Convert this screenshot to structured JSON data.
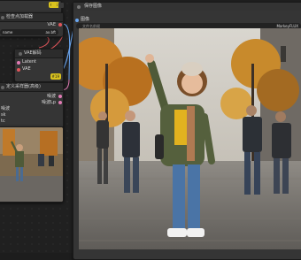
{
  "nodes": {
    "top_left_fragment": {
      "title_tail": "",
      "badge_text": "#16"
    },
    "load_checkpoint": {
      "title": "检查点加载器",
      "vae_label": "VAE",
      "ckpt_value": "ax.bft",
      "ckpt_label": "name"
    },
    "vae_decode": {
      "title": "VAE解码",
      "input_latent": "Latent",
      "input_vae": "VAE",
      "badge_text": "#19"
    },
    "ksampler": {
      "title": "定义采样器(高级)",
      "row1": "噪波",
      "row2": "sk",
      "row3": "tc",
      "right1": "噪波",
      "right2": "噪波Lp"
    },
    "save_image": {
      "title": "保存图像",
      "input_images": "图像",
      "filename_label": "文件名前缀",
      "filename_value": "MarkeyFLUX",
      "badge_text": "#19"
    }
  },
  "colors": {
    "accent_yellow": "#d9c21e",
    "vae_red": "#e0555a",
    "latent_pink": "#e27bb5",
    "image_blue": "#6aa6f0",
    "node_bg": "#353535"
  },
  "icons": [
    "gear-icon",
    "menu-icon"
  ]
}
